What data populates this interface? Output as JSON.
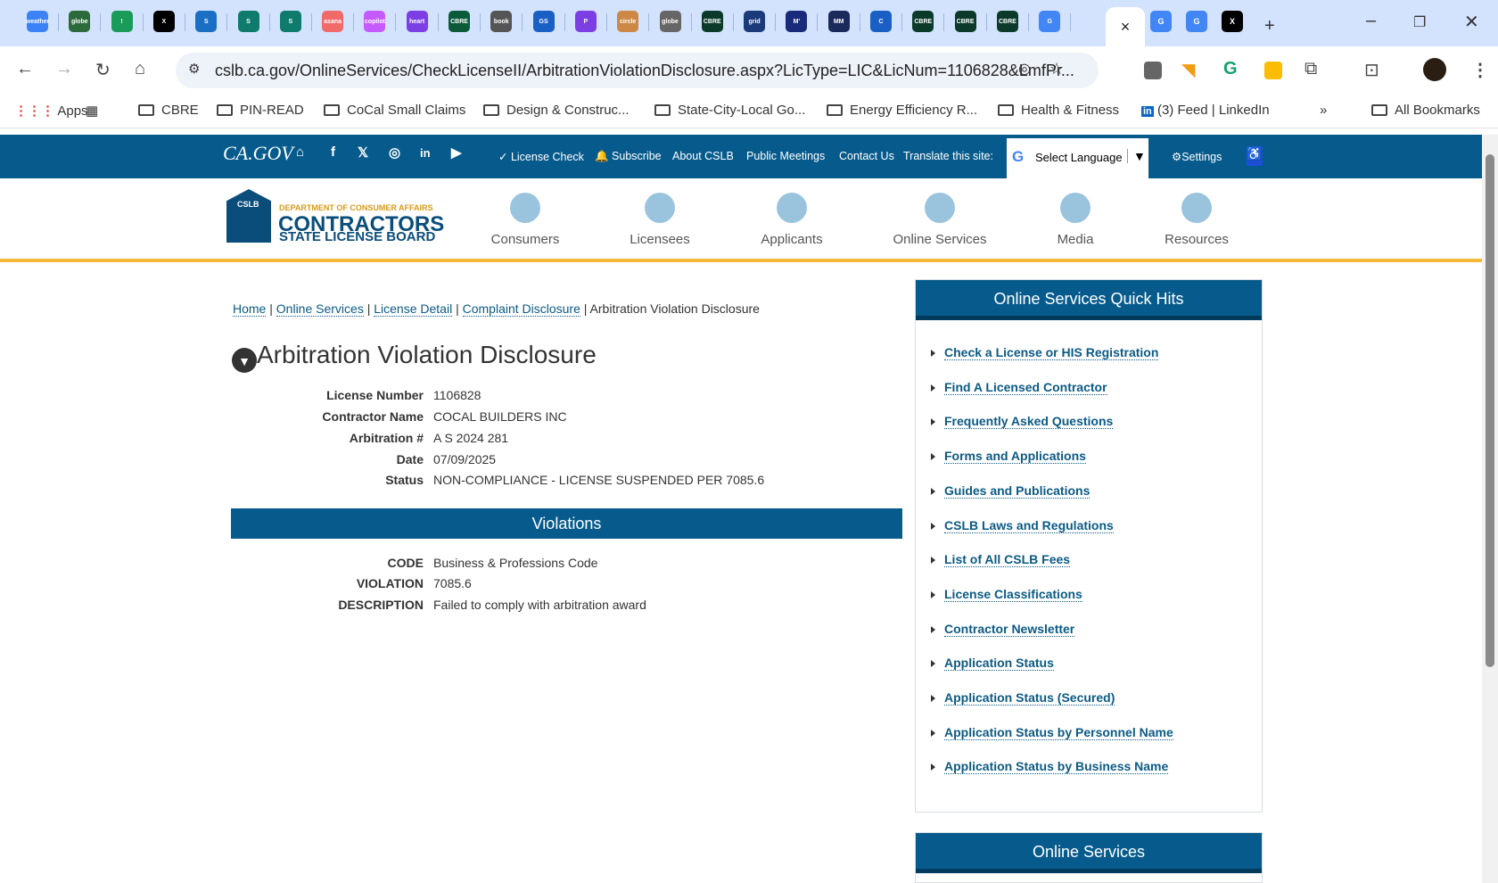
{
  "browser": {
    "tabs": [
      {
        "icon": "weather",
        "c": "#3b82f6"
      },
      {
        "icon": "globe",
        "c": "#2b6a3a"
      },
      {
        "icon": "!",
        "c": "#1a9b5a"
      },
      {
        "icon": "X",
        "c": "#000"
      },
      {
        "icon": "S",
        "c": "#1a6fc4"
      },
      {
        "icon": "S",
        "c": "#0f7b6c"
      },
      {
        "icon": "S",
        "c": "#0f7b6c"
      },
      {
        "icon": "asana",
        "c": "#f06a6a"
      },
      {
        "icon": "copilot",
        "c": "#c55aff"
      },
      {
        "icon": "heart",
        "c": "#7b3fe4"
      },
      {
        "icon": "CBRE",
        "c": "#0b5a3a"
      },
      {
        "icon": "book",
        "c": "#555"
      },
      {
        "icon": "GS",
        "c": "#1a5fc4"
      },
      {
        "icon": "P",
        "c": "#7b3fe4"
      },
      {
        "icon": "circle",
        "c": "#c84"
      },
      {
        "icon": "globe",
        "c": "#666"
      },
      {
        "icon": "CBRE",
        "c": "#0b3a2a"
      },
      {
        "icon": "grid",
        "c": "#1a3a7a"
      },
      {
        "icon": "M'",
        "c": "#1a2a7a"
      },
      {
        "icon": "MM",
        "c": "#1a2a5a"
      },
      {
        "icon": "C",
        "c": "#1a5fc4"
      },
      {
        "icon": "CBRE",
        "c": "#0b3a2a"
      },
      {
        "icon": "CBRE",
        "c": "#0b3a2a"
      },
      {
        "icon": "CBRE",
        "c": "#0b3a2a"
      },
      {
        "icon": "G",
        "c": "#4285f4"
      }
    ],
    "tabs_after": [
      {
        "icon": "G",
        "c": "#4285f4"
      },
      {
        "icon": "G",
        "c": "#4285f4"
      },
      {
        "icon": "X",
        "c": "#000"
      }
    ],
    "active_tab_close": "×",
    "new_tab": "+",
    "url": "cslb.ca.gov/OnlineServices/CheckLicenseII/ArbitrationViolationDisclosure.aspx?LicType=LIC&LicNum=1106828&LmfPr...",
    "bookmarks": {
      "apps": "Apps",
      "items": [
        "CBRE",
        "PIN-READ",
        "CoCal Small Claims",
        "Design & Construc...",
        "State-City-Local Go...",
        "Energy Efficiency R...",
        "Health & Fitness"
      ],
      "linkedin": "(3) Feed | LinkedIn",
      "more": "»",
      "all": "All Bookmarks"
    }
  },
  "topbar": {
    "logo": "CA.GOV",
    "links": [
      "✓ License Check",
      "🔔 Subscribe",
      "About CSLB",
      "Public Meetings",
      "Contact Us"
    ],
    "translate": "Translate this site:",
    "language": "Select Language",
    "settings": "⚙Settings"
  },
  "logo": {
    "dept": "DEPARTMENT OF CONSUMER AFFAIRS",
    "name1": "CONTRACTORS",
    "name2": "STATE LICENSE BOARD",
    "badge": "CSLB"
  },
  "nav": [
    "Consumers",
    "Licensees",
    "Applicants",
    "Online Services",
    "Media",
    "Resources"
  ],
  "breadcrumb": {
    "links": [
      "Home",
      "Online Services",
      "License Detail",
      "Complaint Disclosure"
    ],
    "current": "Arbitration Violation Disclosure"
  },
  "title": "Arbitration Violation Disclosure",
  "fields": [
    {
      "label": "License Number",
      "value": "1106828"
    },
    {
      "label": "Contractor Name",
      "value": "COCAL BUILDERS INC"
    },
    {
      "label": "Arbitration #",
      "value": "A S 2024 281"
    },
    {
      "label": "Date",
      "value": "07/09/2025"
    },
    {
      "label": "Status",
      "value": "NON-COMPLIANCE - LICENSE SUSPENDED PER 7085.6"
    }
  ],
  "violations": {
    "title": "Violations",
    "rows": [
      {
        "label": "CODE",
        "value": "Business & Professions Code"
      },
      {
        "label": "VIOLATION",
        "value": "7085.6"
      },
      {
        "label": "DESCRIPTION",
        "value": "Failed to comply with arbitration award"
      }
    ]
  },
  "quick_hits": {
    "title": "Online Services Quick Hits",
    "items": [
      "Check a License or HIS Registration",
      "Find A Licensed Contractor",
      "Frequently Asked Questions",
      "Forms and Applications",
      "Guides and Publications",
      "CSLB Laws and Regulations",
      "List of All CSLB Fees",
      "License Classifications",
      "Contractor Newsletter",
      "Application Status",
      "Application Status (Secured)",
      "Application Status by Personnel Name",
      "Application Status by Business Name"
    ]
  },
  "online_services": {
    "title": "Online Services"
  }
}
